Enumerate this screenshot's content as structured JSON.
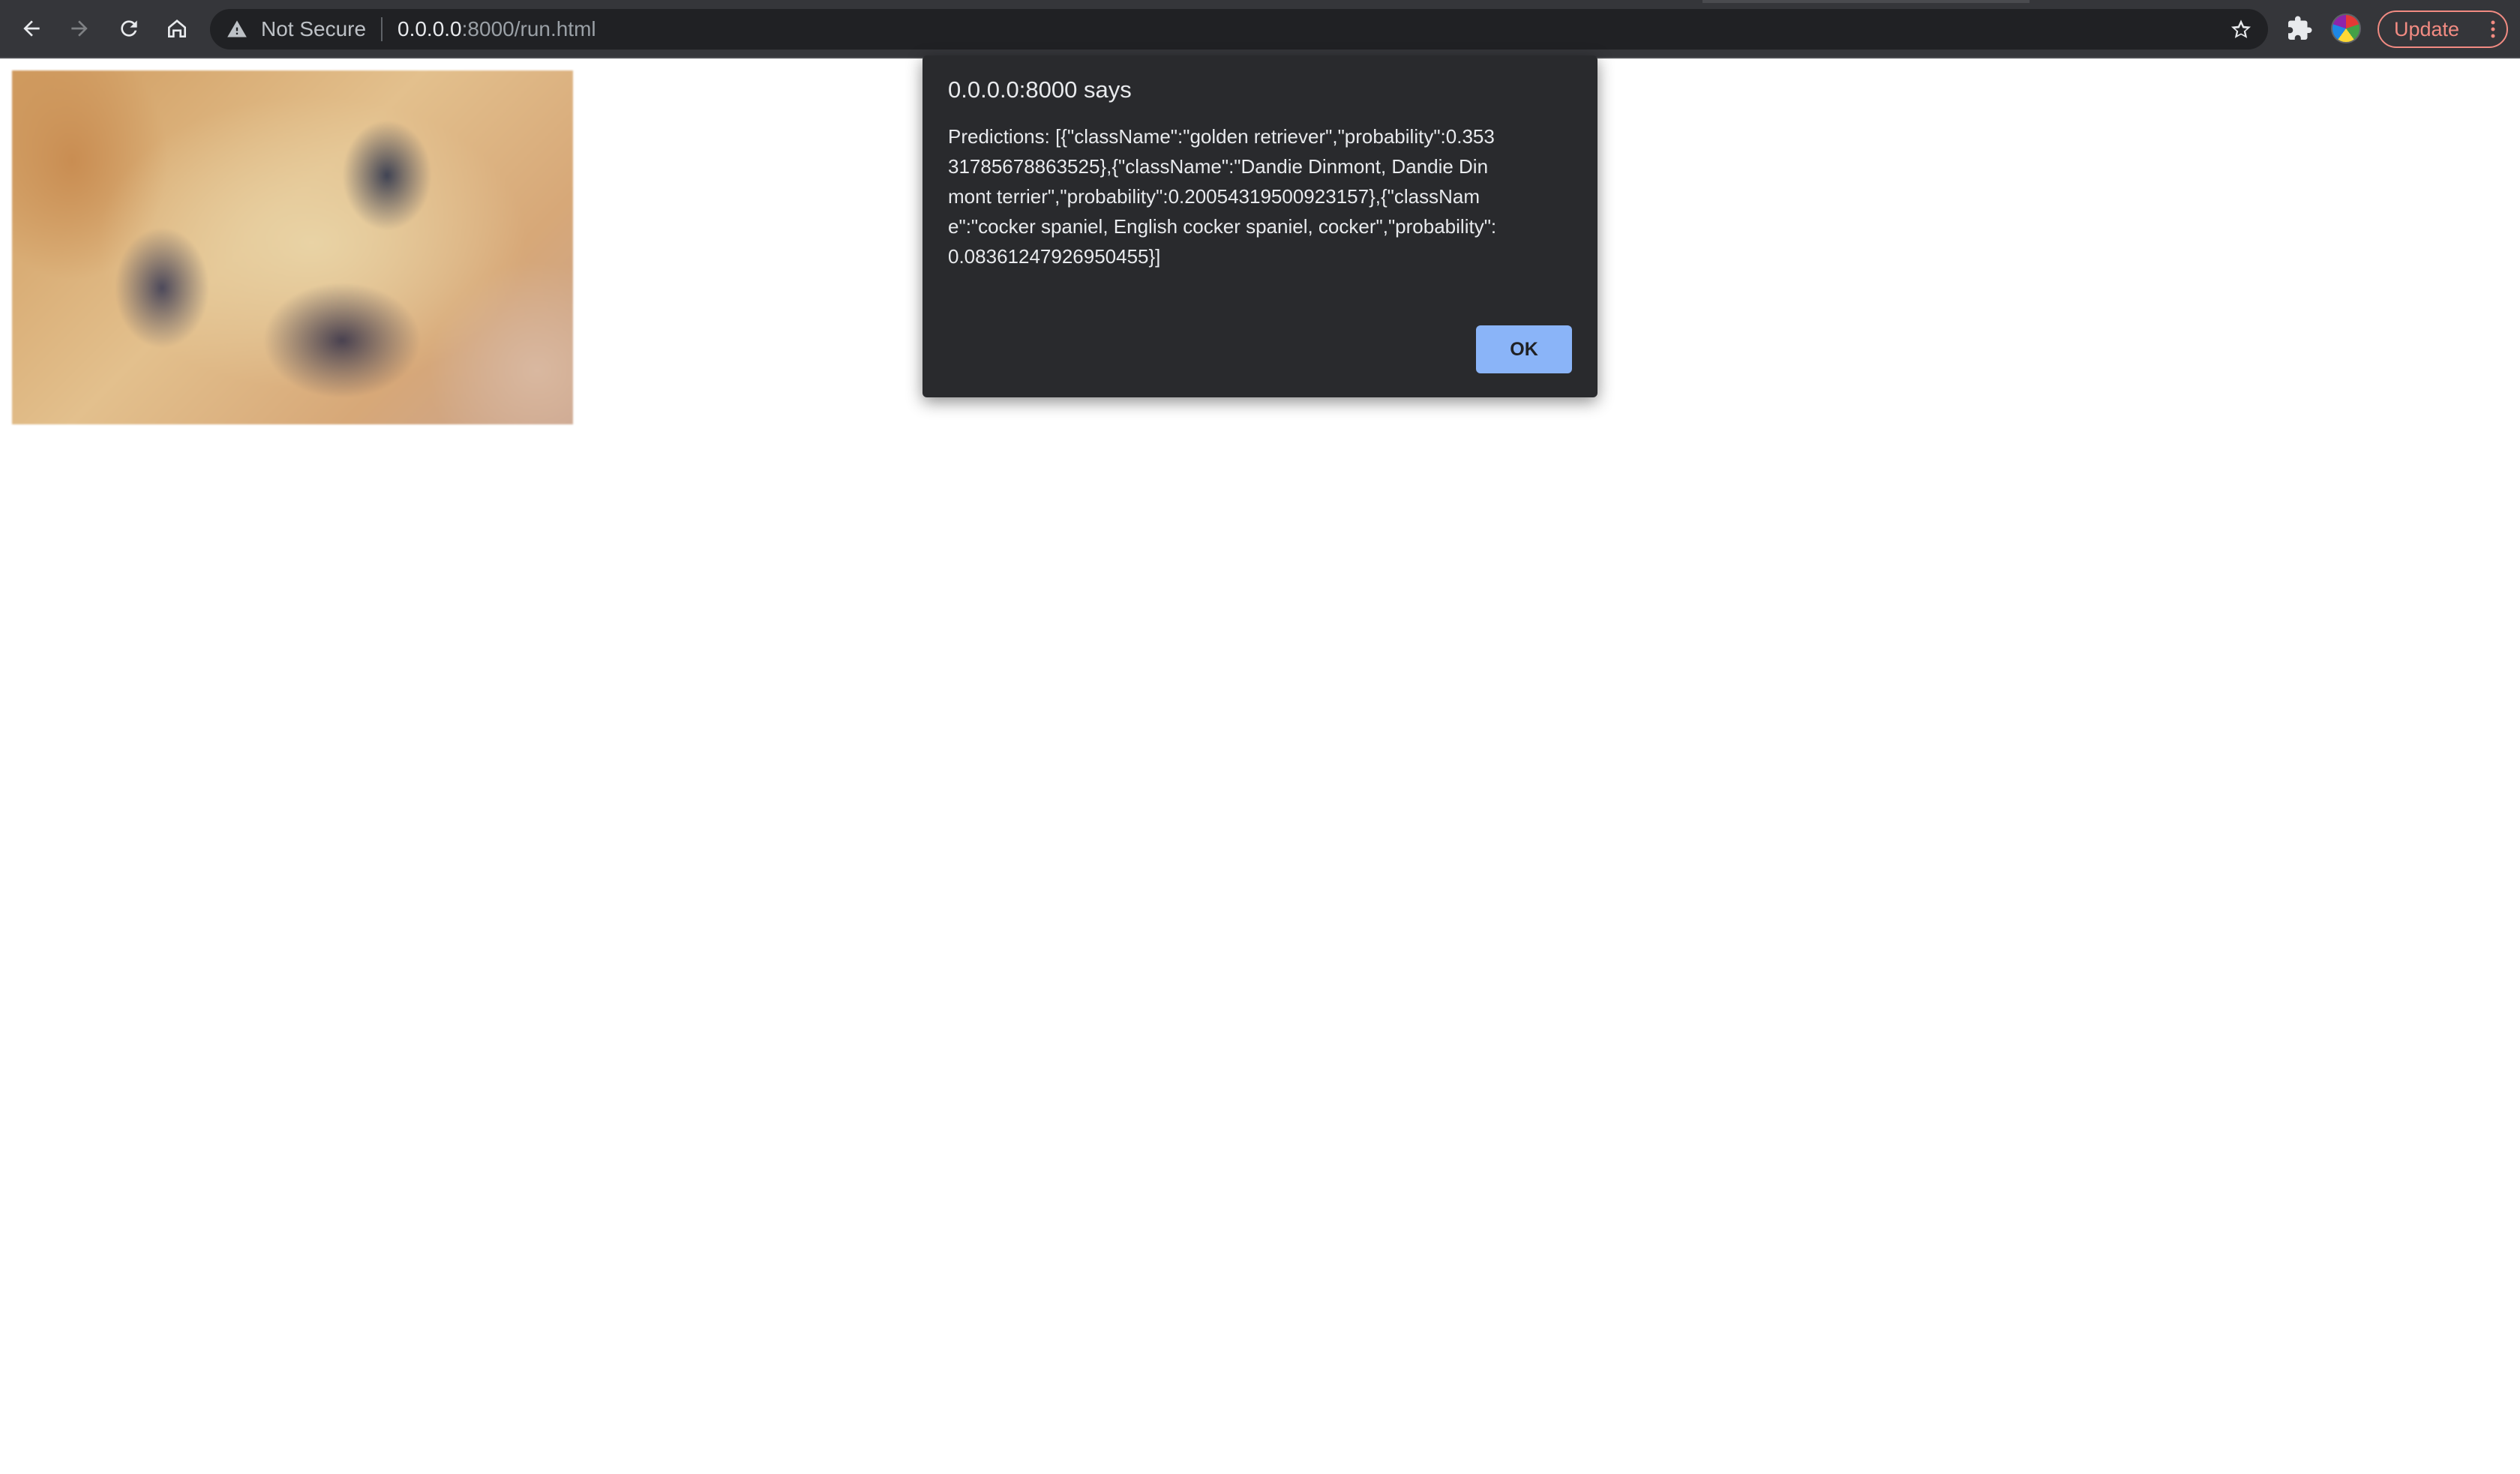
{
  "browser": {
    "security_label": "Not Secure",
    "url_host": "0.0.0.0",
    "url_rest": ":8000/run.html",
    "update_label": "Update",
    "update_color": "#f28b82",
    "icons": [
      "back-icon",
      "forward-icon",
      "reload-icon",
      "home-icon",
      "warning-icon",
      "star-icon",
      "extensions-icon",
      "avatar",
      "kebab-menu-icon"
    ]
  },
  "page": {
    "image_description_icon": "dog-face-photo"
  },
  "dialog": {
    "title": "0.0.0.0:8000 says",
    "message": "Predictions: [{\"className\":\"golden retriever\",\"probability\":0.35331785678863525},{\"className\":\"Dandie Dinmont, Dandie Dinmont terrier\",\"probability\":0.20054319500923157},{\"className\":\"cocker spaniel, English cocker spaniel, cocker\",\"probability\":0.08361247926950455}]",
    "ok_label": "OK",
    "ok_color": "#8ab4f8"
  }
}
